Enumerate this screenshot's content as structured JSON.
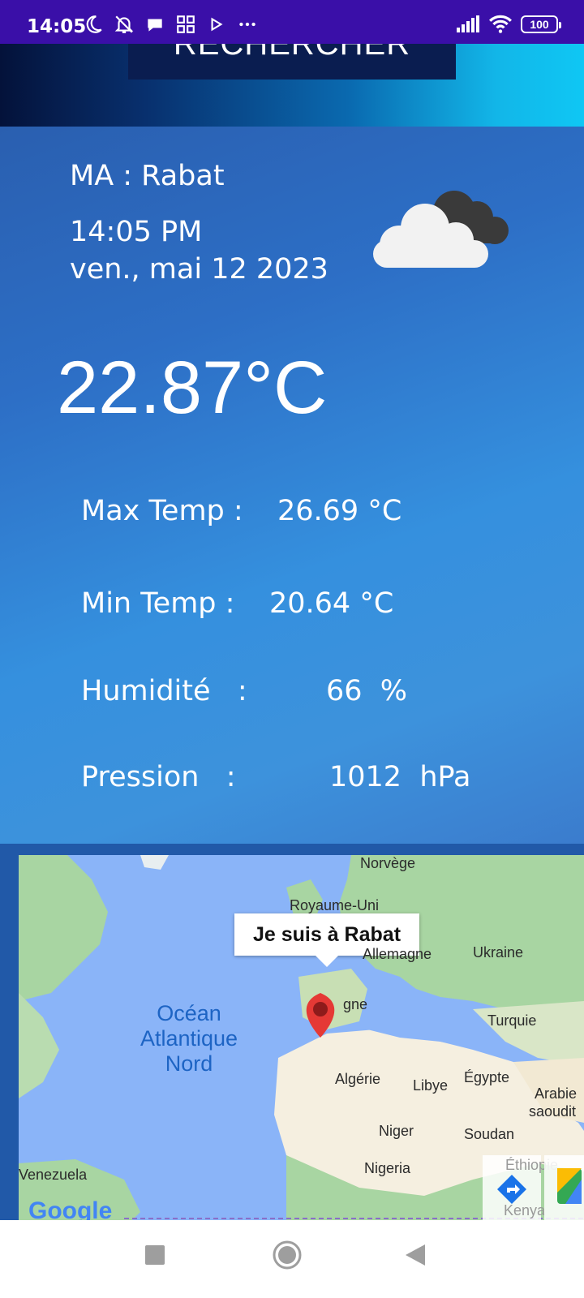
{
  "status_bar": {
    "time": "14:05",
    "battery": "100",
    "icons": [
      "moon-icon",
      "bell-off-icon",
      "chat-bubble-icon",
      "apps-grid-icon",
      "play-icon",
      "more-dots-icon",
      "signal-icon",
      "wifi-icon",
      "battery-icon"
    ]
  },
  "header": {
    "search_button_label": "RECHERCHER"
  },
  "weather": {
    "location": "MA  :  Rabat",
    "time": "14:05 PM",
    "date": "ven., mai 12 2023",
    "temperature": "22.87°C",
    "condition_icon": "cloudy-icon",
    "rows": [
      {
        "label": "Max Temp :",
        "value": "26.69 °C"
      },
      {
        "label": "Min Temp :",
        "value": "20.64 °C"
      },
      {
        "label": "Humidité   :",
        "value": "66  %"
      },
      {
        "label": "Pression   :",
        "value": "1012  hPa"
      }
    ]
  },
  "map": {
    "info_window": "Je suis à Rabat",
    "ocean_label": "Océan Atlantique Nord",
    "places": [
      "Norvège",
      "Royaume-Uni",
      "Allemagne",
      "Ukraine",
      "gne",
      "Turquie",
      "Algérie",
      "Libye",
      "Égypte",
      "Arabie",
      "saoudit",
      "Niger",
      "Soudan",
      "Nigeria",
      "Éthiopie",
      "Kenya",
      "Venezuela"
    ],
    "attribution": "Google",
    "colors": {
      "water": "#8ab4f8",
      "land_green": "#a8d5a2",
      "land_desert": "#f5efe0"
    }
  },
  "nav_bar": {
    "buttons": [
      "recents-square-icon",
      "home-circle-icon",
      "back-triangle-icon"
    ]
  }
}
